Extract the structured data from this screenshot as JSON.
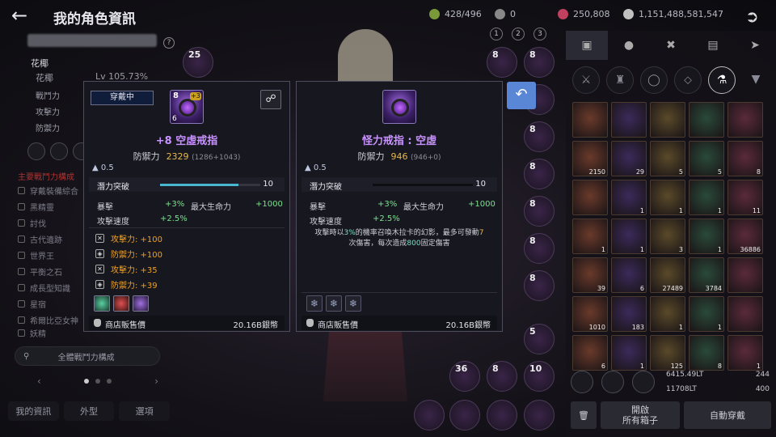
{
  "header": {
    "title": "我的角色資訊",
    "currencies": [
      {
        "icon": "energy-icon",
        "value": "428/496",
        "color": "#7a9a3a"
      },
      {
        "icon": "coin-icon",
        "value": "0",
        "color": "#888888"
      },
      {
        "icon": "diamond-icon",
        "value": "250,808",
        "color": "#c04060"
      },
      {
        "icon": "silver-icon",
        "value": "1,151,488,581,547",
        "color": "#c0c0c0"
      }
    ]
  },
  "left": {
    "guild_name": "花椰",
    "guild_sub": "花椰",
    "level": "Lv 105.73%",
    "stats": [
      "戰鬥力",
      "攻擊力",
      "防禦力"
    ],
    "menu_section": "主要戰鬥力構成",
    "menu": [
      "穿戴裝備綜合",
      "黑精靈",
      "討伐",
      "古代遺跡",
      "世界王",
      "平衡之石",
      "成長型知識",
      "星宿",
      "希爾比亞女神",
      "妖精"
    ],
    "all_guild_button": "全體戰鬥力構成",
    "tabs": [
      "我的資訊",
      "外型",
      "選項"
    ]
  },
  "slot_numbers": [
    "1",
    "2",
    "3"
  ],
  "equip_card": {
    "badge": "穿戴中",
    "enhance": "8",
    "plus_badge": "+3",
    "count": "6",
    "name": "+8 空虛戒指",
    "def_label": "防禦力",
    "def_value": "2329",
    "def_sub": "(1286+1043)",
    "weight": "0.5",
    "potential_label": "潛力突破",
    "potential_value": "10",
    "potential_fill": 0.78,
    "stats": [
      {
        "label": "暴擊",
        "value": "+3%"
      },
      {
        "label": "最大生命力",
        "value": "+1000"
      },
      {
        "label": "攻擊速度",
        "value": "+2.5%"
      }
    ],
    "bonuses": [
      {
        "text": "攻擊力: +100",
        "icon": "sword-icon"
      },
      {
        "text": "防禦力: +100",
        "icon": "shield-icon"
      },
      {
        "text": "攻擊力: +35",
        "icon": "sword-icon"
      },
      {
        "text": "防禦力: +39",
        "icon": "shield-icon"
      }
    ],
    "sell_label": "商店販售價",
    "sell_value": "20.16B銀幣"
  },
  "compare_card": {
    "name": "怪力戒指 : 空虛",
    "def_label": "防禦力",
    "def_value": "946",
    "def_sub": "(946+0)",
    "weight": "0.5",
    "potential_label": "潛力突破",
    "potential_value": "10",
    "potential_fill": 0.0,
    "stats": [
      {
        "label": "暴擊",
        "value": "+3%"
      },
      {
        "label": "最大生命力",
        "value": "+1000"
      },
      {
        "label": "攻擊速度",
        "value": "+2.5%"
      }
    ],
    "desc_1": "攻擊時以",
    "desc_pct": "3%",
    "desc_2": "的機率召喚木拉卡的幻影，最多可發動",
    "desc_n": "7",
    "desc_3": "次傷害，每次造成",
    "desc_dmg": "800",
    "desc_4": "固定傷害",
    "sell_label": "商店販售價",
    "sell_value": "20.16B銀幣"
  },
  "inventory": {
    "cells": [
      {
        "q": ""
      },
      {
        "q": ""
      },
      {
        "q": ""
      },
      {
        "q": ""
      },
      {
        "q": ""
      },
      {
        "q": "2150"
      },
      {
        "q": "29"
      },
      {
        "q": "5"
      },
      {
        "q": "5"
      },
      {
        "q": "8"
      },
      {
        "q": ""
      },
      {
        "q": "1"
      },
      {
        "q": "1"
      },
      {
        "q": "1"
      },
      {
        "q": "11"
      },
      {
        "q": "1"
      },
      {
        "q": "1"
      },
      {
        "q": "3"
      },
      {
        "q": "1"
      },
      {
        "q": "36886"
      },
      {
        "q": "39"
      },
      {
        "q": "6"
      },
      {
        "q": "27489"
      },
      {
        "q": "3784"
      },
      {
        "q": ""
      },
      {
        "q": "1010"
      },
      {
        "q": "183"
      },
      {
        "q": "1"
      },
      {
        "q": "1"
      },
      {
        "q": ""
      },
      {
        "q": "6"
      },
      {
        "q": "1"
      },
      {
        "q": "125"
      },
      {
        "q": "8"
      },
      {
        "q": "1"
      }
    ],
    "weight_1": "6415.49LT",
    "weight_2": "11708LT",
    "slots_1": "244",
    "slots_2": "400",
    "open_all_label": "開啟\n所有箱子",
    "auto_equip_label": "自動穿戴"
  }
}
